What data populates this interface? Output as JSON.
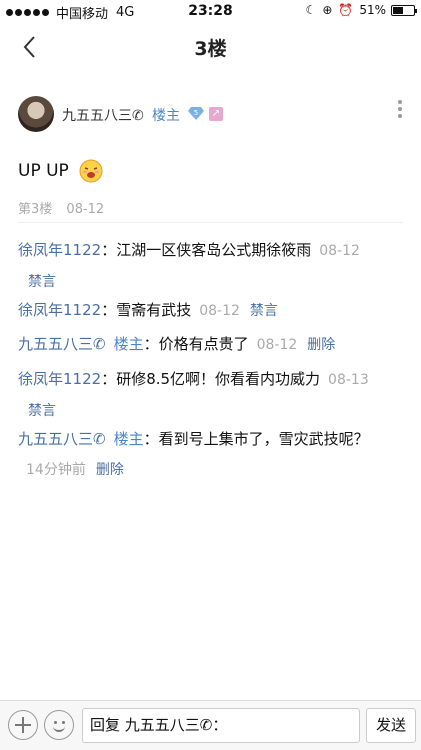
{
  "status_bar": {
    "carrier": "中国移动",
    "network": "4G",
    "time": "23:28",
    "battery_percent": "51%",
    "battery_level": 0.51,
    "signal_filled": 5,
    "icons": [
      "moon-icon",
      "lock-rotation-icon",
      "alarm-icon"
    ]
  },
  "nav": {
    "title": "3楼",
    "back_icon": "chevron-left-icon"
  },
  "post": {
    "author": "九五五八三✆",
    "owner_tag": "楼主",
    "level_badge": "5",
    "content": "UP UP",
    "floor": "第3楼",
    "date": "08-12"
  },
  "replies": [
    {
      "user": "徐凤年1122",
      "owner_tag": "",
      "text": "：江湖一区侠客岛公式期徐筱雨",
      "time": "08-12",
      "action": "禁言"
    },
    {
      "user": "徐凤年1122",
      "owner_tag": "",
      "text": "：雪斋有武技",
      "time": "08-12",
      "action": "禁言"
    },
    {
      "user": "九五五八三✆",
      "owner_tag": "楼主",
      "text": "：价格有点贵了",
      "time": "08-12",
      "action": "删除"
    },
    {
      "user": "徐凤年1122",
      "owner_tag": "",
      "text": "：研修8.5亿啊！你看看内功威力",
      "time": "08-13",
      "action": "禁言"
    },
    {
      "user": "九五五八三✆",
      "owner_tag": "楼主",
      "text": "：看到号上集市了，雪灾武技呢？",
      "time": "14分钟前",
      "action": "删除"
    }
  ],
  "bottom_bar": {
    "input_value": "回复 九五五八三✆：",
    "send_label": "发送"
  },
  "colors": {
    "link_blue": "#4a6fa5",
    "owner_blue": "#4a86c8",
    "muted_gray": "#aaaaaa"
  }
}
